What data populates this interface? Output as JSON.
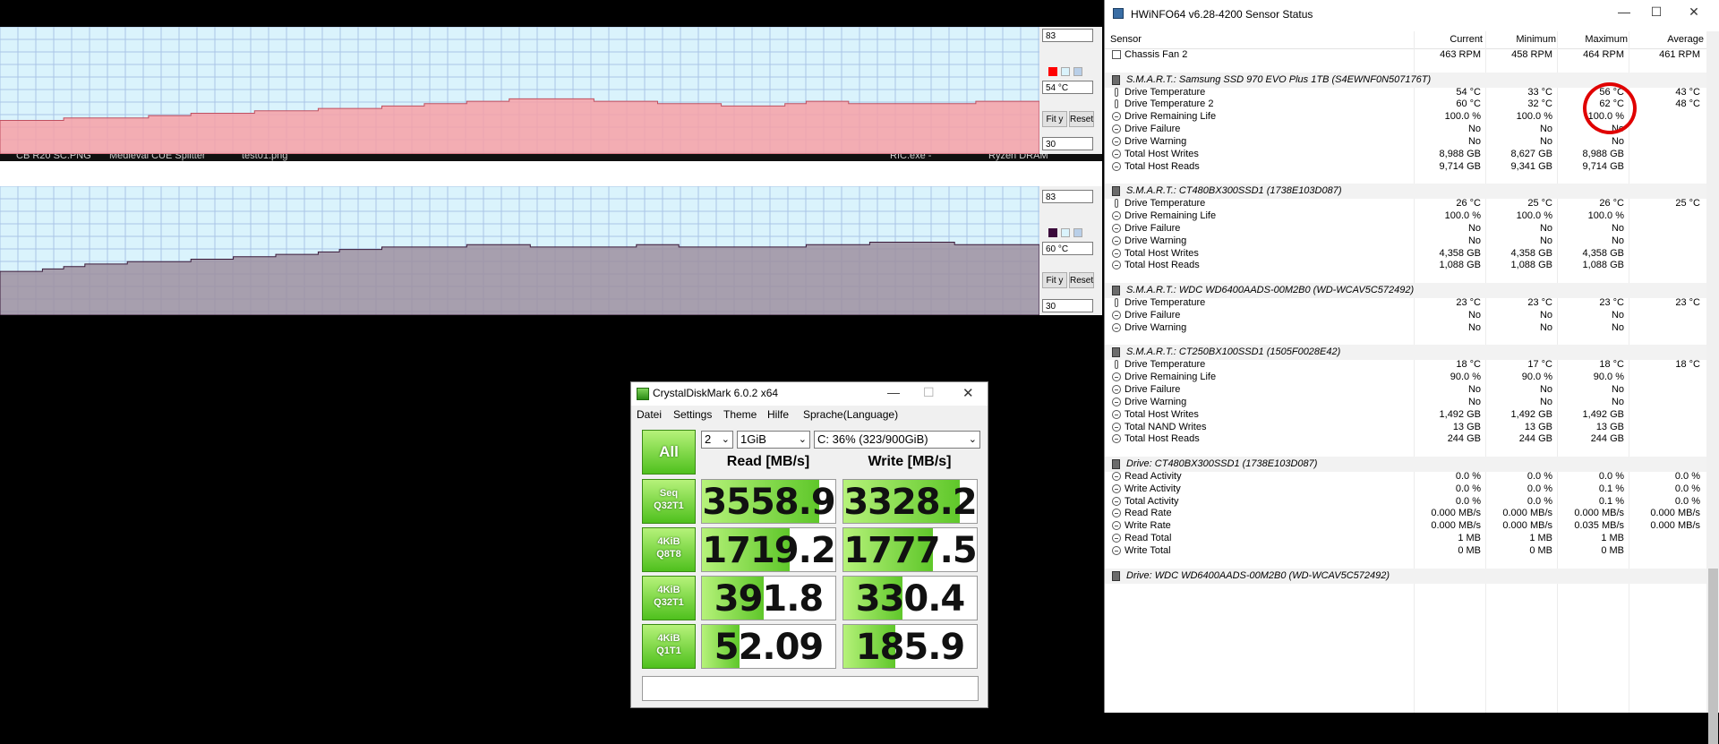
{
  "graphs": [
    {
      "max_label": "83",
      "current_label": "54 °C",
      "min_label": "30",
      "fit_label": "Fit y",
      "reset_label": "Reset",
      "series_color": "#f7a0a6",
      "line_color": "#c05060",
      "swatch_color": "#ff0000",
      "values": [
        44,
        44,
        44,
        45,
        45,
        45,
        45,
        46,
        46,
        47,
        47,
        47,
        48,
        48,
        48,
        49,
        49,
        49,
        50,
        50,
        51,
        51,
        52,
        52,
        53,
        53,
        53,
        53,
        52,
        52,
        52,
        51,
        51,
        51,
        50,
        50,
        50,
        51,
        52,
        52,
        51,
        51,
        51,
        51,
        51,
        51,
        52,
        52,
        52
      ]
    },
    {
      "max_label": "83",
      "current_label": "60 °C",
      "min_label": "30",
      "fit_label": "Fit y",
      "reset_label": "Reset",
      "series_color": "#9e8fa0",
      "line_color": "#3a1a3a",
      "swatch_color": "#3b0a3b",
      "values": [
        48,
        48,
        49,
        50,
        51,
        51,
        52,
        52,
        52,
        53,
        53,
        54,
        54,
        55,
        55,
        56,
        57,
        57,
        58,
        58,
        58,
        58,
        59,
        59,
        59,
        58,
        58,
        58,
        58,
        58,
        59,
        59,
        58,
        58,
        58,
        58,
        58,
        58,
        59,
        59,
        59,
        60,
        60,
        60,
        60,
        59,
        59,
        59,
        59
      ]
    }
  ],
  "taskbar": [
    "CB R20 SC.PNG",
    "Medieval CUE Splitter",
    "test01.png",
    "RIC.exe -",
    "Ryzen DRAM"
  ],
  "hwinfo": {
    "title": "HWiNFO64 v6.28-4200 Sensor Status",
    "columns": [
      "Sensor",
      "Current",
      "Minimum",
      "Maximum",
      "Average"
    ],
    "rows": [
      {
        "t": "fan",
        "name": "Chassis Fan 2",
        "cur": "463 RPM",
        "min": "458 RPM",
        "max": "464 RPM",
        "avg": "461 RPM"
      },
      {
        "t": "blank"
      },
      {
        "t": "sect",
        "name": "S.M.A.R.T.: Samsung SSD 970 EVO Plus 1TB (S4EWNF0N507176T)"
      },
      {
        "t": "therm",
        "name": "Drive Temperature",
        "cur": "54 °C",
        "min": "33 °C",
        "max": "56 °C",
        "avg": "43 °C"
      },
      {
        "t": "therm",
        "name": "Drive Temperature 2",
        "cur": "60 °C",
        "min": "32 °C",
        "max": "62 °C",
        "avg": "48 °C"
      },
      {
        "t": "circ",
        "name": "Drive Remaining Life",
        "cur": "100.0 %",
        "min": "100.0 %",
        "max": "100.0 %",
        "avg": ""
      },
      {
        "t": "circ",
        "name": "Drive Failure",
        "cur": "No",
        "min": "No",
        "max": "No",
        "avg": ""
      },
      {
        "t": "circ",
        "name": "Drive Warning",
        "cur": "No",
        "min": "No",
        "max": "No",
        "avg": ""
      },
      {
        "t": "circ",
        "name": "Total Host Writes",
        "cur": "8,988 GB",
        "min": "8,627 GB",
        "max": "8,988 GB",
        "avg": ""
      },
      {
        "t": "circ",
        "name": "Total Host Reads",
        "cur": "9,714 GB",
        "min": "9,341 GB",
        "max": "9,714 GB",
        "avg": ""
      },
      {
        "t": "blank"
      },
      {
        "t": "sect",
        "name": "S.M.A.R.T.: CT480BX300SSD1 (1738E103D087)"
      },
      {
        "t": "therm",
        "name": "Drive Temperature",
        "cur": "26 °C",
        "min": "25 °C",
        "max": "26 °C",
        "avg": "25 °C"
      },
      {
        "t": "circ",
        "name": "Drive Remaining Life",
        "cur": "100.0 %",
        "min": "100.0 %",
        "max": "100.0 %",
        "avg": ""
      },
      {
        "t": "circ",
        "name": "Drive Failure",
        "cur": "No",
        "min": "No",
        "max": "No",
        "avg": ""
      },
      {
        "t": "circ",
        "name": "Drive Warning",
        "cur": "No",
        "min": "No",
        "max": "No",
        "avg": ""
      },
      {
        "t": "circ",
        "name": "Total Host Writes",
        "cur": "4,358 GB",
        "min": "4,358 GB",
        "max": "4,358 GB",
        "avg": ""
      },
      {
        "t": "circ",
        "name": "Total Host Reads",
        "cur": "1,088 GB",
        "min": "1,088 GB",
        "max": "1,088 GB",
        "avg": ""
      },
      {
        "t": "blank"
      },
      {
        "t": "sect",
        "name": "S.M.A.R.T.: WDC WD6400AADS-00M2B0 (WD-WCAV5C572492)"
      },
      {
        "t": "therm",
        "name": "Drive Temperature",
        "cur": "23 °C",
        "min": "23 °C",
        "max": "23 °C",
        "avg": "23 °C"
      },
      {
        "t": "circ",
        "name": "Drive Failure",
        "cur": "No",
        "min": "No",
        "max": "No",
        "avg": ""
      },
      {
        "t": "circ",
        "name": "Drive Warning",
        "cur": "No",
        "min": "No",
        "max": "No",
        "avg": ""
      },
      {
        "t": "blank"
      },
      {
        "t": "sect",
        "name": "S.M.A.R.T.: CT250BX100SSD1 (1505F0028E42)"
      },
      {
        "t": "therm",
        "name": "Drive Temperature",
        "cur": "18 °C",
        "min": "17 °C",
        "max": "18 °C",
        "avg": "18 °C"
      },
      {
        "t": "circ",
        "name": "Drive Remaining Life",
        "cur": "90.0 %",
        "min": "90.0 %",
        "max": "90.0 %",
        "avg": ""
      },
      {
        "t": "circ",
        "name": "Drive Failure",
        "cur": "No",
        "min": "No",
        "max": "No",
        "avg": ""
      },
      {
        "t": "circ",
        "name": "Drive Warning",
        "cur": "No",
        "min": "No",
        "max": "No",
        "avg": ""
      },
      {
        "t": "circ",
        "name": "Total Host Writes",
        "cur": "1,492 GB",
        "min": "1,492 GB",
        "max": "1,492 GB",
        "avg": ""
      },
      {
        "t": "circ",
        "name": "Total NAND Writes",
        "cur": "13 GB",
        "min": "13 GB",
        "max": "13 GB",
        "avg": ""
      },
      {
        "t": "circ",
        "name": "Total Host Reads",
        "cur": "244 GB",
        "min": "244 GB",
        "max": "244 GB",
        "avg": ""
      },
      {
        "t": "blank"
      },
      {
        "t": "sect",
        "name": "Drive: CT480BX300SSD1 (1738E103D087)"
      },
      {
        "t": "circ",
        "name": "Read Activity",
        "cur": "0.0 %",
        "min": "0.0 %",
        "max": "0.0 %",
        "avg": "0.0 %"
      },
      {
        "t": "circ",
        "name": "Write Activity",
        "cur": "0.0 %",
        "min": "0.0 %",
        "max": "0.1 %",
        "avg": "0.0 %"
      },
      {
        "t": "circ",
        "name": "Total Activity",
        "cur": "0.0 %",
        "min": "0.0 %",
        "max": "0.1 %",
        "avg": "0.0 %"
      },
      {
        "t": "circ",
        "name": "Read Rate",
        "cur": "0.000 MB/s",
        "min": "0.000 MB/s",
        "max": "0.000 MB/s",
        "avg": "0.000 MB/s"
      },
      {
        "t": "circ",
        "name": "Write Rate",
        "cur": "0.000 MB/s",
        "min": "0.000 MB/s",
        "max": "0.035 MB/s",
        "avg": "0.000 MB/s"
      },
      {
        "t": "circ",
        "name": "Read Total",
        "cur": "1 MB",
        "min": "1 MB",
        "max": "1 MB",
        "avg": ""
      },
      {
        "t": "circ",
        "name": "Write Total",
        "cur": "0 MB",
        "min": "0 MB",
        "max": "0 MB",
        "avg": ""
      },
      {
        "t": "blank"
      },
      {
        "t": "sect",
        "name": "Drive: WDC WD6400AADS-00M2B0 (WD-WCAV5C572492)"
      }
    ]
  },
  "cdm": {
    "title": "CrystalDiskMark 6.0.2 x64",
    "menu": [
      "Datei",
      "Settings",
      "Theme",
      "Hilfe",
      "Sprache(Language)"
    ],
    "all_label": "All",
    "count": "2",
    "size": "1GiB",
    "drive": "C: 36% (323/900GiB)",
    "read_header": "Read [MB/s]",
    "write_header": "Write [MB/s]",
    "tests": [
      {
        "l1": "Seq",
        "l2": "Q32T1",
        "read": "3558.9",
        "write": "3328.2",
        "read_fill": 0.88,
        "write_fill": 0.87
      },
      {
        "l1": "4KiB",
        "l2": "Q8T8",
        "read": "1719.2",
        "write": "1777.5",
        "read_fill": 0.66,
        "write_fill": 0.67
      },
      {
        "l1": "4KiB",
        "l2": "Q32T1",
        "read": "391.8",
        "write": "330.4",
        "read_fill": 0.46,
        "write_fill": 0.44
      },
      {
        "l1": "4KiB",
        "l2": "Q1T1",
        "read": "52.09",
        "write": "185.9",
        "read_fill": 0.28,
        "write_fill": 0.39
      }
    ]
  }
}
